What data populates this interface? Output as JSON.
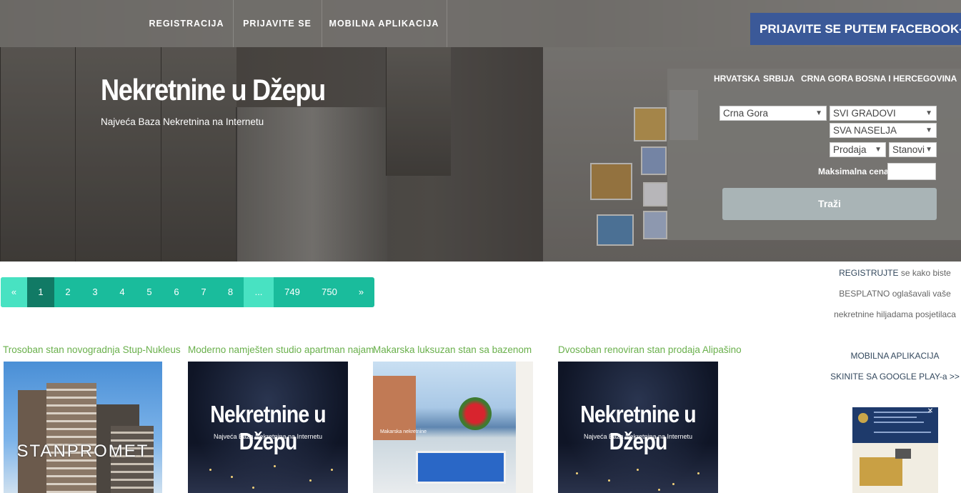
{
  "nav": {
    "items": [
      "REGISTRACIJA",
      "PRIJAVITE SE",
      "MOBILNA APLIKACIJA"
    ],
    "facebook_login": "PRIJAVITE SE PUTEM FACEBOOK-A"
  },
  "hero": {
    "title": "Nekretnine u Džepu",
    "subtitle": "Najveća Baza Nekretnina na Internetu"
  },
  "search": {
    "countries": [
      "HRVATSKA",
      "SRBIJA",
      "CRNA GORA",
      "BOSNA I HERCEGOVINA"
    ],
    "country_select": "Crna Gora",
    "city_select": "SVI GRADOVI",
    "settlement_select": "SVA NASELJA",
    "type_select": "Prodaja",
    "property_select": "Stanovi",
    "max_price_label": "Maksimalna cena:",
    "max_price_value": "",
    "submit": "Traži"
  },
  "pagination": {
    "prev": "«",
    "pages": [
      "1",
      "2",
      "3",
      "4",
      "5",
      "6",
      "7",
      "8"
    ],
    "ellipsis": "...",
    "last_pages": [
      "749",
      "750"
    ],
    "next": "»",
    "current": "1"
  },
  "sidebar": {
    "register_link": "REGISTRUJTE",
    "register_text_1": " se kako biste",
    "register_text_2": "BESPLATNO oglašavali vaše",
    "register_text_3": "nekretnine hiljadama posjetilaca",
    "mobile_app": "MOBILNA APLIKACIJA",
    "google_play": "SKINITE SA GOOGLE PLAY-a >>",
    "ad_close": "✕"
  },
  "listings": [
    {
      "title": "Trosoban stan novogradnja Stup-Nukleus",
      "image_text": "STANPROMET"
    },
    {
      "title": "Moderno namješten studio apartman najam",
      "image_title": "Nekretnine u Džepu",
      "image_sub": "Najveća Baza Nekretnina na Internetu"
    },
    {
      "title": "Makarska luksuzan stan sa bazenom",
      "image_caption": "Makarska nekretnine"
    },
    {
      "title": "Dvosoban renoviran stan prodaja Alipašino",
      "image_title": "Nekretnine u Džepu",
      "image_sub": "Najveća Baza Nekretnina na Internetu"
    }
  ],
  "colors": {
    "accent": "#1abc9c",
    "accent_dark": "#117a65",
    "facebook": "#3b5998",
    "listing_title": "#6ab04c"
  }
}
